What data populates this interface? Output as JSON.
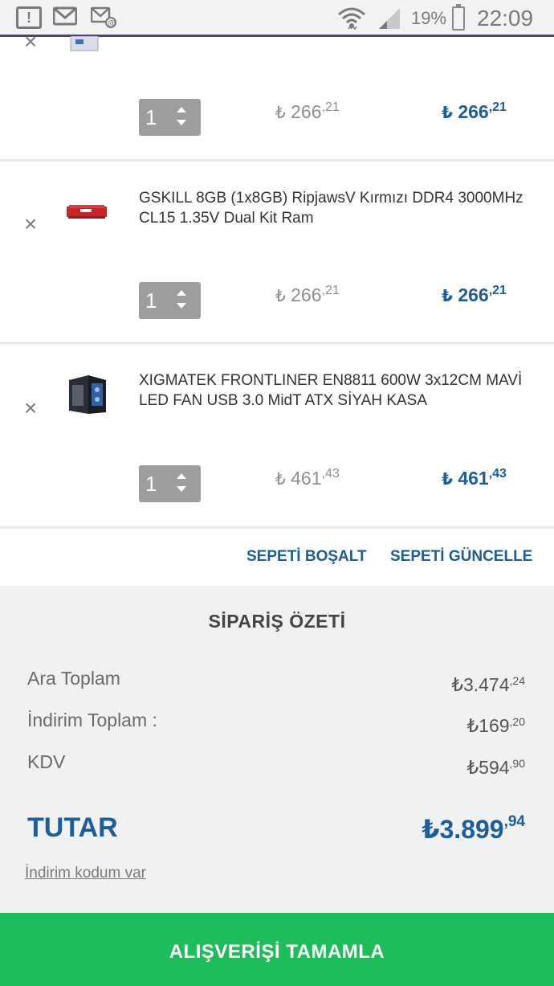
{
  "status_bar": {
    "battery_percent": "19%",
    "time": "22:09",
    "icons": [
      "alert-icon",
      "gmail-icon",
      "mail-alert-icon",
      "wifi-icon",
      "signal-icon",
      "battery-icon"
    ]
  },
  "cart": {
    "items": [
      {
        "title": "",
        "quantity": "1",
        "old_price_int": "266",
        "old_price_dec": ",21",
        "price_int": "266",
        "price_dec": ",21"
      },
      {
        "title": "GSKILL 8GB (1x8GB) RipjawsV Kırmızı DDR4 3000MHz CL15 1.35V Dual Kit Ram",
        "quantity": "1",
        "old_price_int": "266",
        "old_price_dec": ",21",
        "price_int": "266",
        "price_dec": ",21"
      },
      {
        "title": "XIGMATEK FRONTLINER EN8811 600W 3x12CM MAVİ LED FAN USB 3.0 MidT ATX SİYAH KASA",
        "quantity": "1",
        "old_price_int": "461",
        "old_price_dec": ",43",
        "price_int": "461",
        "price_dec": ",43"
      }
    ],
    "currency_symbol": "₺",
    "empty_cart_label": "SEPETİ BOŞALT",
    "update_cart_label": "SEPETİ GÜNCELLE"
  },
  "summary": {
    "title": "SİPARİŞ ÖZETİ",
    "subtotal_label": "Ara Toplam",
    "subtotal_int": "₺3.474",
    "subtotal_dec": ",24",
    "discount_label": "İndirim Toplam :",
    "discount_int": "₺169",
    "discount_dec": ",20",
    "tax_label": "KDV",
    "tax_int": "₺594",
    "tax_dec": ",90",
    "total_label": "TUTAR",
    "total_int": "₺3.899",
    "total_dec": ",94",
    "discount_code_link": "İndirim kodum var"
  },
  "checkout_label": "ALIŞVERİŞİ TAMAMLA",
  "colors": {
    "accent_blue": "#1c5d9c",
    "checkout_green": "#1fbc5a",
    "statusbar_line": "#4b3d8f"
  }
}
